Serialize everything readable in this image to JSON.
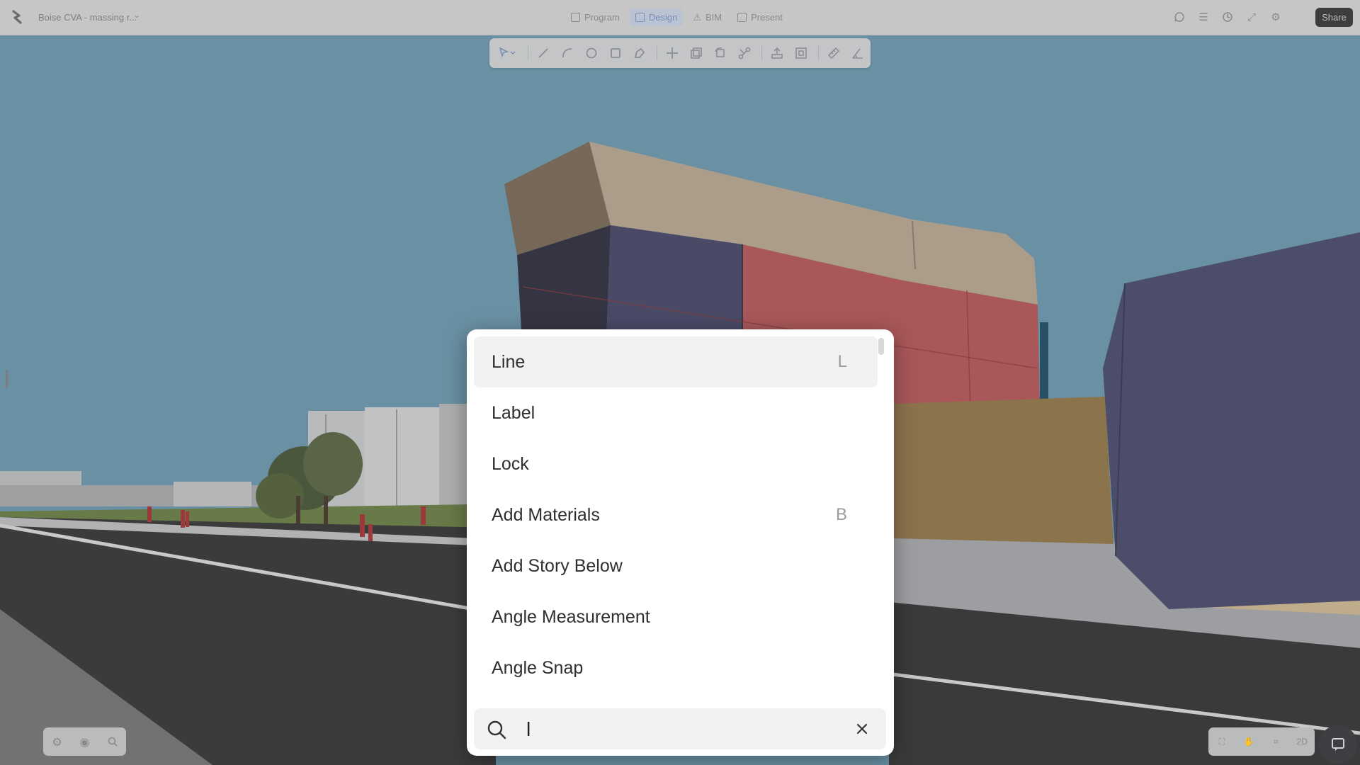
{
  "app": {
    "project_title": "Boise CVA - massing r...",
    "share_label": "Share"
  },
  "modes": [
    {
      "label": "Program",
      "active": false,
      "icon": "program-icon"
    },
    {
      "label": "Design",
      "active": true,
      "icon": "design-icon"
    },
    {
      "label": "BIM",
      "active": false,
      "icon": "bim-icon"
    },
    {
      "label": "Present",
      "active": false,
      "icon": "present-icon"
    }
  ],
  "topbar_icons": [
    "comment-icon",
    "layers-list-icon",
    "clock-history-icon",
    "expand-icon",
    "settings-icon"
  ],
  "toolbar": {
    "tools": [
      "select-icon",
      "line-icon",
      "arc-icon",
      "circle-icon",
      "rectangle-icon",
      "polygon-icon",
      "move-icon",
      "copy-icon",
      "rotate-icon",
      "scale-icon",
      "extrude-icon",
      "offset-icon",
      "measure-icon",
      "angle-icon"
    ]
  },
  "palette": {
    "commands": [
      {
        "label": "Line",
        "shortcut": "L"
      },
      {
        "label": "Label",
        "shortcut": ""
      },
      {
        "label": "Lock",
        "shortcut": ""
      },
      {
        "label": "Add Materials",
        "shortcut": "B"
      },
      {
        "label": "Add Story Below",
        "shortcut": ""
      },
      {
        "label": "Angle Measurement",
        "shortcut": ""
      },
      {
        "label": "Angle Snap",
        "shortcut": ""
      }
    ],
    "selected_index": 0,
    "search": {
      "value": "l",
      "placeholder": ""
    }
  },
  "view_controls": {
    "bottom_left": [
      "settings-icon",
      "view-eye-icon",
      "zoom-icon"
    ],
    "bottom_right": [
      "fit-view-icon",
      "pan-hand-icon",
      "frame-icon"
    ],
    "view_mode_label": "2D"
  },
  "colors": {
    "sky": "#6f9aaf",
    "accent_blue": "#7a8fb7",
    "building_red": "#b55a5c",
    "building_navy": "#4b4b6a",
    "building_tan": "#b9a994",
    "podium_ochre": "#957a4f",
    "road": "#3a3a3c"
  }
}
